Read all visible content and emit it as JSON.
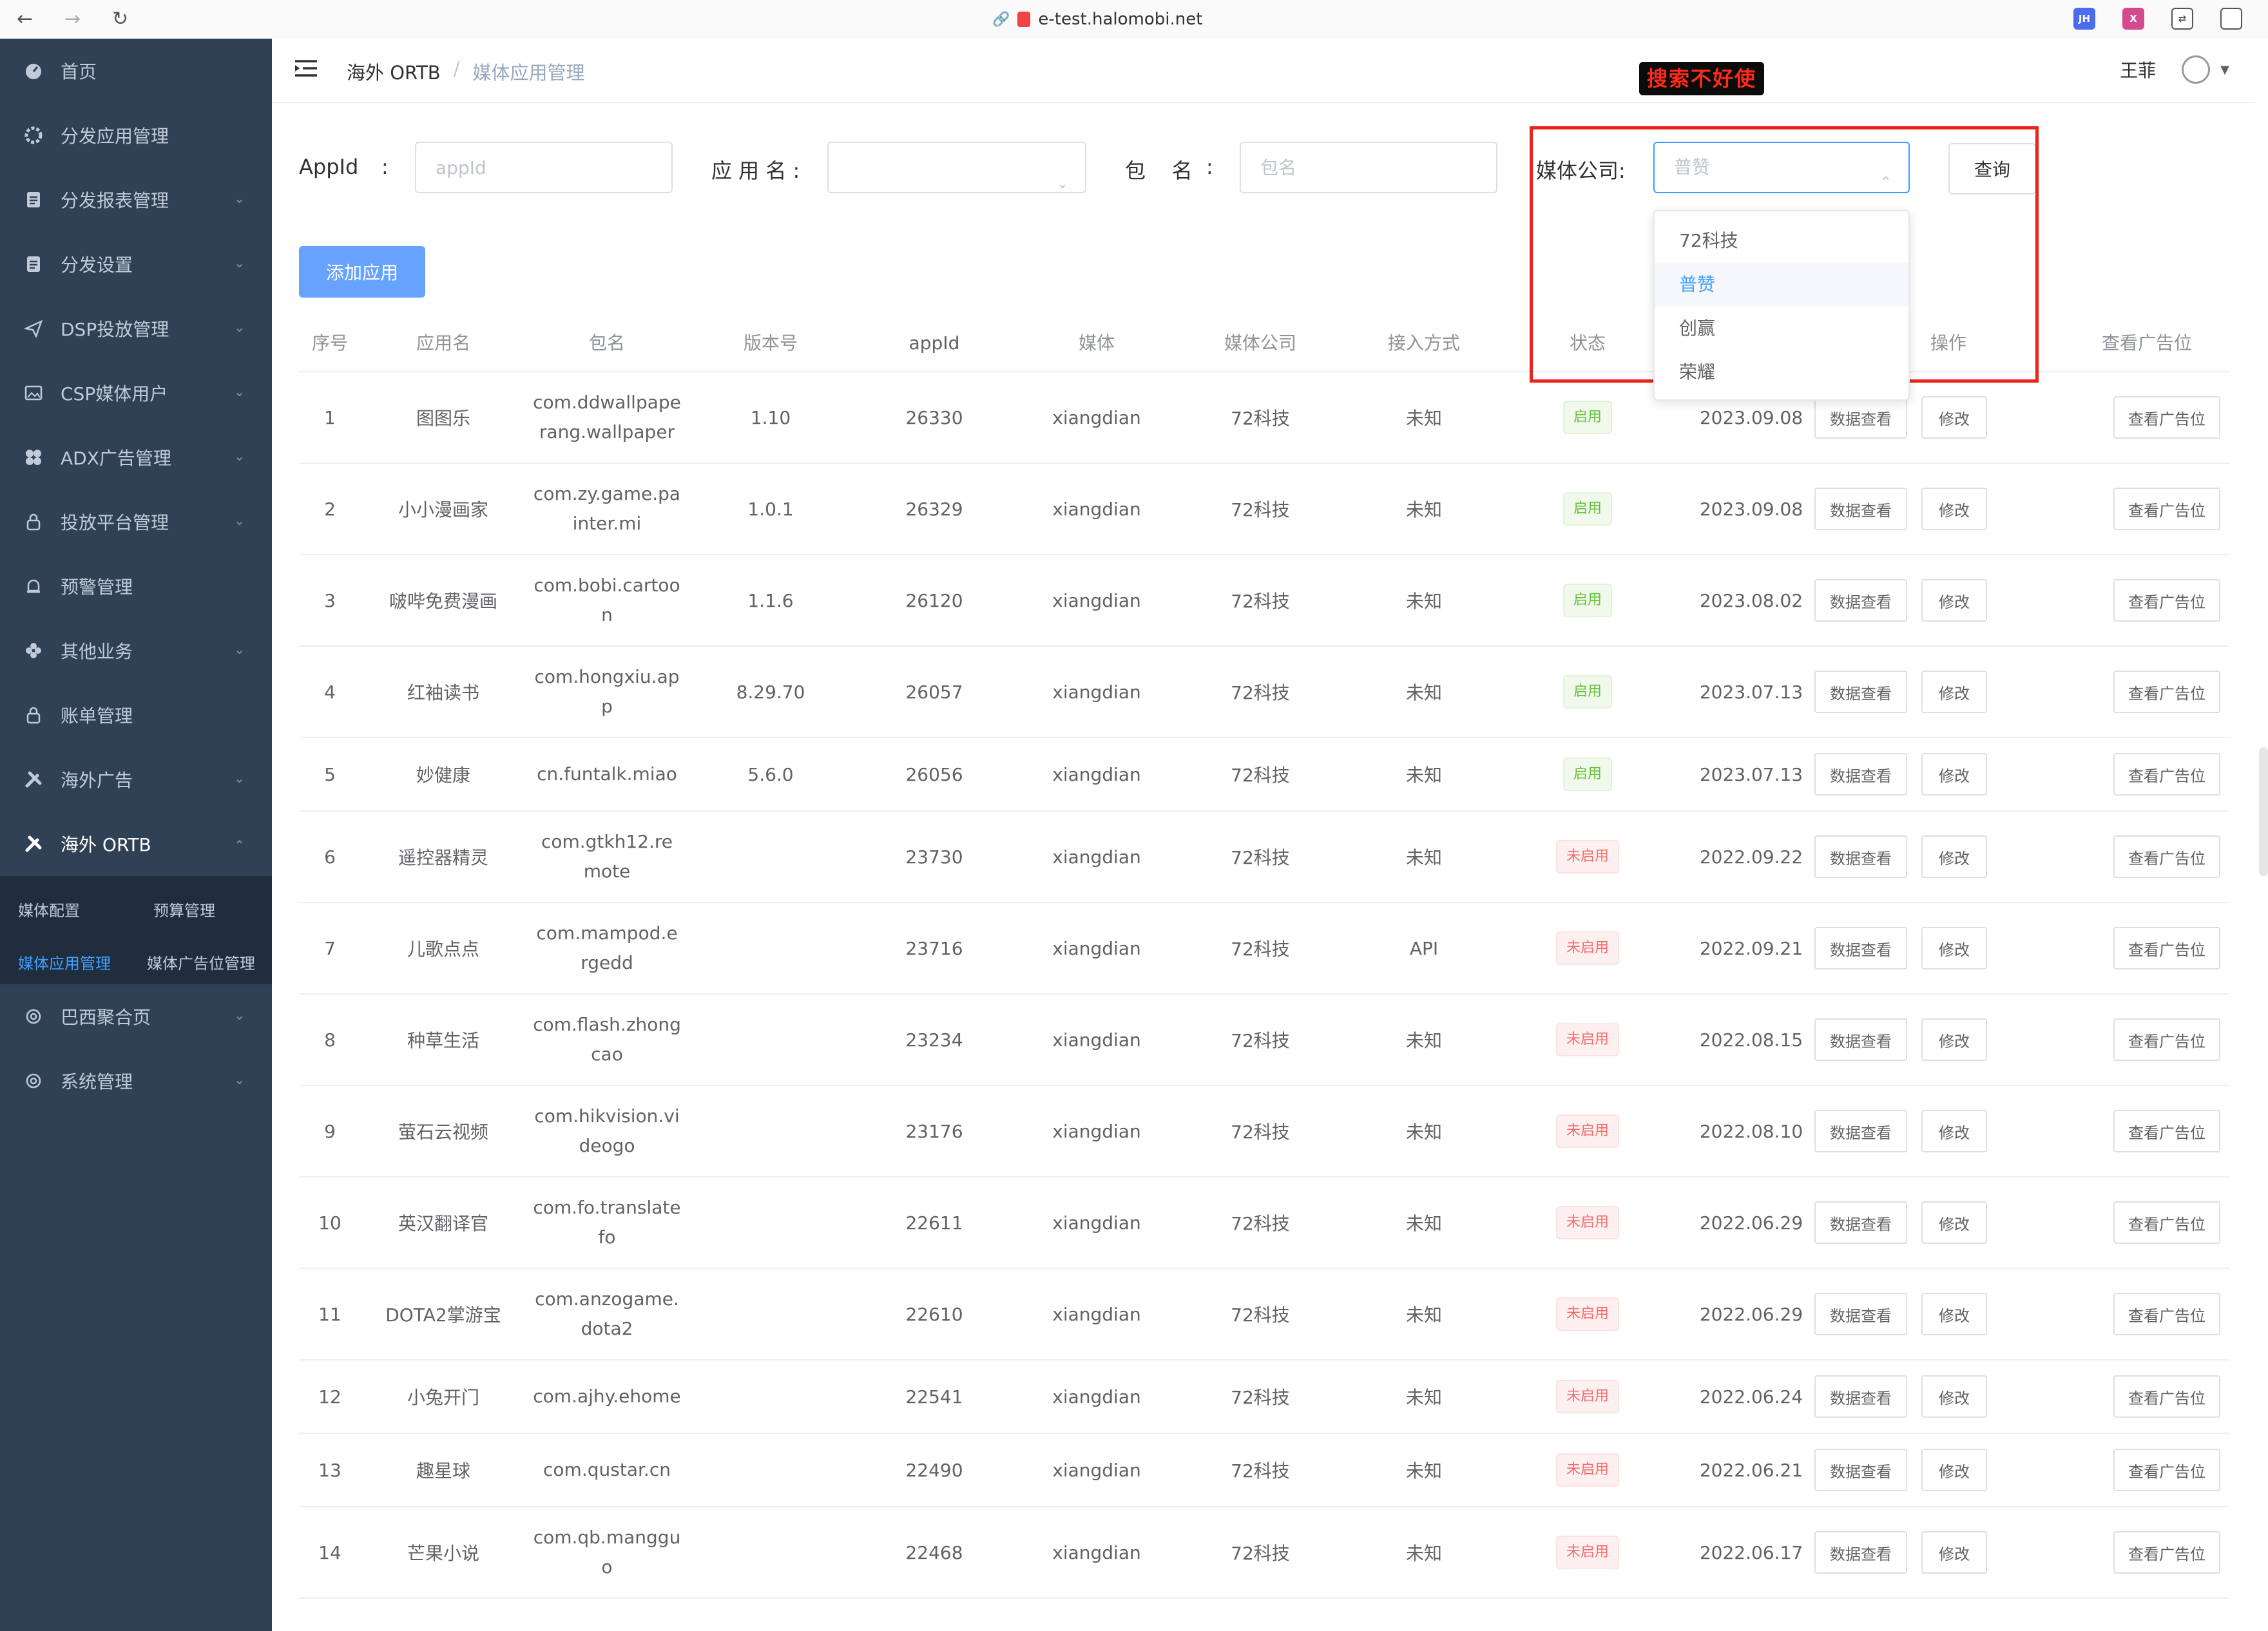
{
  "browser": {
    "url": "e-test.halomobi.net",
    "ext_labels": [
      "JH",
      "X"
    ]
  },
  "sidebar": {
    "items": [
      {
        "label": "首页"
      },
      {
        "label": "分发应用管理"
      },
      {
        "label": "分发报表管理"
      },
      {
        "label": "分发设置"
      },
      {
        "label": "DSP投放管理"
      },
      {
        "label": "CSP媒体用户"
      },
      {
        "label": "ADX广告管理"
      },
      {
        "label": "投放平台管理"
      },
      {
        "label": "预警管理"
      },
      {
        "label": "其他业务"
      },
      {
        "label": "账单管理"
      },
      {
        "label": "海外广告"
      },
      {
        "label": "海外 ORTB"
      },
      {
        "label": "巴西聚合页"
      },
      {
        "label": "系统管理"
      }
    ],
    "submenu": [
      "媒体配置",
      "预算管理",
      "媒体应用管理",
      "媒体广告位管理"
    ]
  },
  "header": {
    "crumb_parent": "海外 ORTB",
    "crumb_sep": "/",
    "crumb_current": "媒体应用管理",
    "user_name": "王菲"
  },
  "annotation": "搜索不好使",
  "filters": {
    "appid_label": "AppId",
    "colon": ":",
    "appid_placeholder": "appId",
    "appname_label": "应 用 名 :",
    "pkg_label": "包    名",
    "pkg_placeholder": "包名",
    "media_label": "媒体公司:",
    "media_value": "普赞",
    "query_label": "查询",
    "add_label": "添加应用"
  },
  "media_options": [
    "72科技",
    "普赞",
    "创赢",
    "荣耀"
  ],
  "table": {
    "headers": [
      "序号",
      "应用名",
      "包名",
      "版本号",
      "appId",
      "媒体",
      "媒体公司",
      "接入方式",
      "状态",
      "",
      "操作",
      "查看广告位"
    ],
    "action_data": "数据查看",
    "action_edit": "修改",
    "action_slots": "查看广告位",
    "rows": [
      {
        "no": "1",
        "name": "图图乐",
        "pkg": "com.ddwallpaperang.wallpaper",
        "ver": "1.10",
        "appid": "26330",
        "media": "xiangdian",
        "company": "72科技",
        "access": "未知",
        "status": "启用",
        "on": true,
        "date": "2023.09.08"
      },
      {
        "no": "2",
        "name": "小小漫画家",
        "pkg": "com.zy.game.painter.mi",
        "ver": "1.0.1",
        "appid": "26329",
        "media": "xiangdian",
        "company": "72科技",
        "access": "未知",
        "status": "启用",
        "on": true,
        "date": "2023.09.08"
      },
      {
        "no": "3",
        "name": "啵哔免费漫画",
        "pkg": "com.bobi.cartoon",
        "ver": "1.1.6",
        "appid": "26120",
        "media": "xiangdian",
        "company": "72科技",
        "access": "未知",
        "status": "启用",
        "on": true,
        "date": "2023.08.02"
      },
      {
        "no": "4",
        "name": "红袖读书",
        "pkg": "com.hongxiu.app",
        "ver": "8.29.70",
        "appid": "26057",
        "media": "xiangdian",
        "company": "72科技",
        "access": "未知",
        "status": "启用",
        "on": true,
        "date": "2023.07.13"
      },
      {
        "no": "5",
        "name": "妙健康",
        "pkg": "cn.funtalk.miao",
        "ver": "5.6.0",
        "appid": "26056",
        "media": "xiangdian",
        "company": "72科技",
        "access": "未知",
        "status": "启用",
        "on": true,
        "date": "2023.07.13"
      },
      {
        "no": "6",
        "name": "遥控器精灵",
        "pkg": "com.gtkh12.remote",
        "ver": "",
        "appid": "23730",
        "media": "xiangdian",
        "company": "72科技",
        "access": "未知",
        "status": "未启用",
        "on": false,
        "date": "2022.09.22"
      },
      {
        "no": "7",
        "name": "儿歌点点",
        "pkg": "com.mampod.ergedd",
        "ver": "",
        "appid": "23716",
        "media": "xiangdian",
        "company": "72科技",
        "access": "API",
        "status": "未启用",
        "on": false,
        "date": "2022.09.21"
      },
      {
        "no": "8",
        "name": "种草生活",
        "pkg": "com.flash.zhongcao",
        "ver": "",
        "appid": "23234",
        "media": "xiangdian",
        "company": "72科技",
        "access": "未知",
        "status": "未启用",
        "on": false,
        "date": "2022.08.15"
      },
      {
        "no": "9",
        "name": "萤石云视频",
        "pkg": "com.hikvision.videogo",
        "ver": "",
        "appid": "23176",
        "media": "xiangdian",
        "company": "72科技",
        "access": "未知",
        "status": "未启用",
        "on": false,
        "date": "2022.08.10"
      },
      {
        "no": "10",
        "name": "英汉翻译官",
        "pkg": "com.fo.translatefo",
        "ver": "",
        "appid": "22611",
        "media": "xiangdian",
        "company": "72科技",
        "access": "未知",
        "status": "未启用",
        "on": false,
        "date": "2022.06.29"
      },
      {
        "no": "11",
        "name": "DOTA2掌游宝",
        "pkg": "com.anzogame.dota2",
        "ver": "",
        "appid": "22610",
        "media": "xiangdian",
        "company": "72科技",
        "access": "未知",
        "status": "未启用",
        "on": false,
        "date": "2022.06.29"
      },
      {
        "no": "12",
        "name": "小兔开门",
        "pkg": "com.ajhy.ehome",
        "ver": "",
        "appid": "22541",
        "media": "xiangdian",
        "company": "72科技",
        "access": "未知",
        "status": "未启用",
        "on": false,
        "date": "2022.06.24"
      },
      {
        "no": "13",
        "name": "趣星球",
        "pkg": "com.qustar.cn",
        "ver": "",
        "appid": "22490",
        "media": "xiangdian",
        "company": "72科技",
        "access": "未知",
        "status": "未启用",
        "on": false,
        "date": "2022.06.21"
      },
      {
        "no": "14",
        "name": "芒果小说",
        "pkg": "com.qb.mangguo",
        "ver": "",
        "appid": "22468",
        "media": "xiangdian",
        "company": "72科技",
        "access": "未知",
        "status": "未启用",
        "on": false,
        "date": "2022.06.17"
      }
    ]
  }
}
